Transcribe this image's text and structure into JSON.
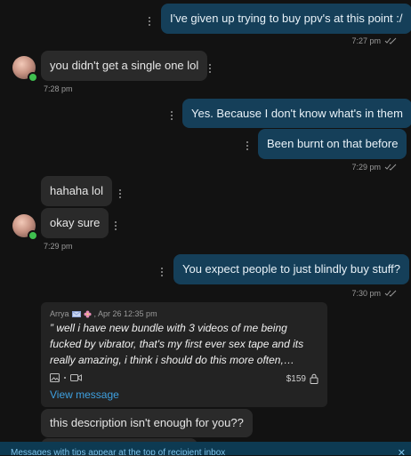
{
  "messages": {
    "m1": {
      "text": "I've given up trying to buy ppv's at this point :/",
      "time": "7:27 pm"
    },
    "m2": {
      "text": "you didn't get a single one lol",
      "time": "7:28 pm"
    },
    "m3": {
      "text": "Yes. Because I don't know what's in them"
    },
    "m4": {
      "text": "Been burnt on that before",
      "time": "7:29 pm"
    },
    "m5": {
      "text": "hahaha lol"
    },
    "m6": {
      "text": "okay sure",
      "time": "7:29 pm"
    },
    "m7": {
      "text": "You expect people to just blindly buy stuff?",
      "time": "7:30 pm"
    }
  },
  "quote": {
    "author": "Arrya",
    "date": ", Apr 26 12:35 pm",
    "text": "” well i have new bundle with 3 videos of me being fucked by vibrator, that's my first ever sex tape and its really amazing, i think i should do this more often, pure…",
    "price": "$159",
    "view_link": "View message",
    "badge_icons": [
      "mail-icon",
      "flower-icon"
    ]
  },
  "reply": {
    "text": "this description isn't enough for you??"
  },
  "banner": {
    "text": "Messages with tips appear at the top of recipient inbox",
    "close": "✕"
  },
  "colors": {
    "outgoing": "#153f59",
    "incoming": "#2a2a2a",
    "link": "#3ea0e0",
    "online": "#3fbf4f",
    "banner": "#0d3a52"
  }
}
